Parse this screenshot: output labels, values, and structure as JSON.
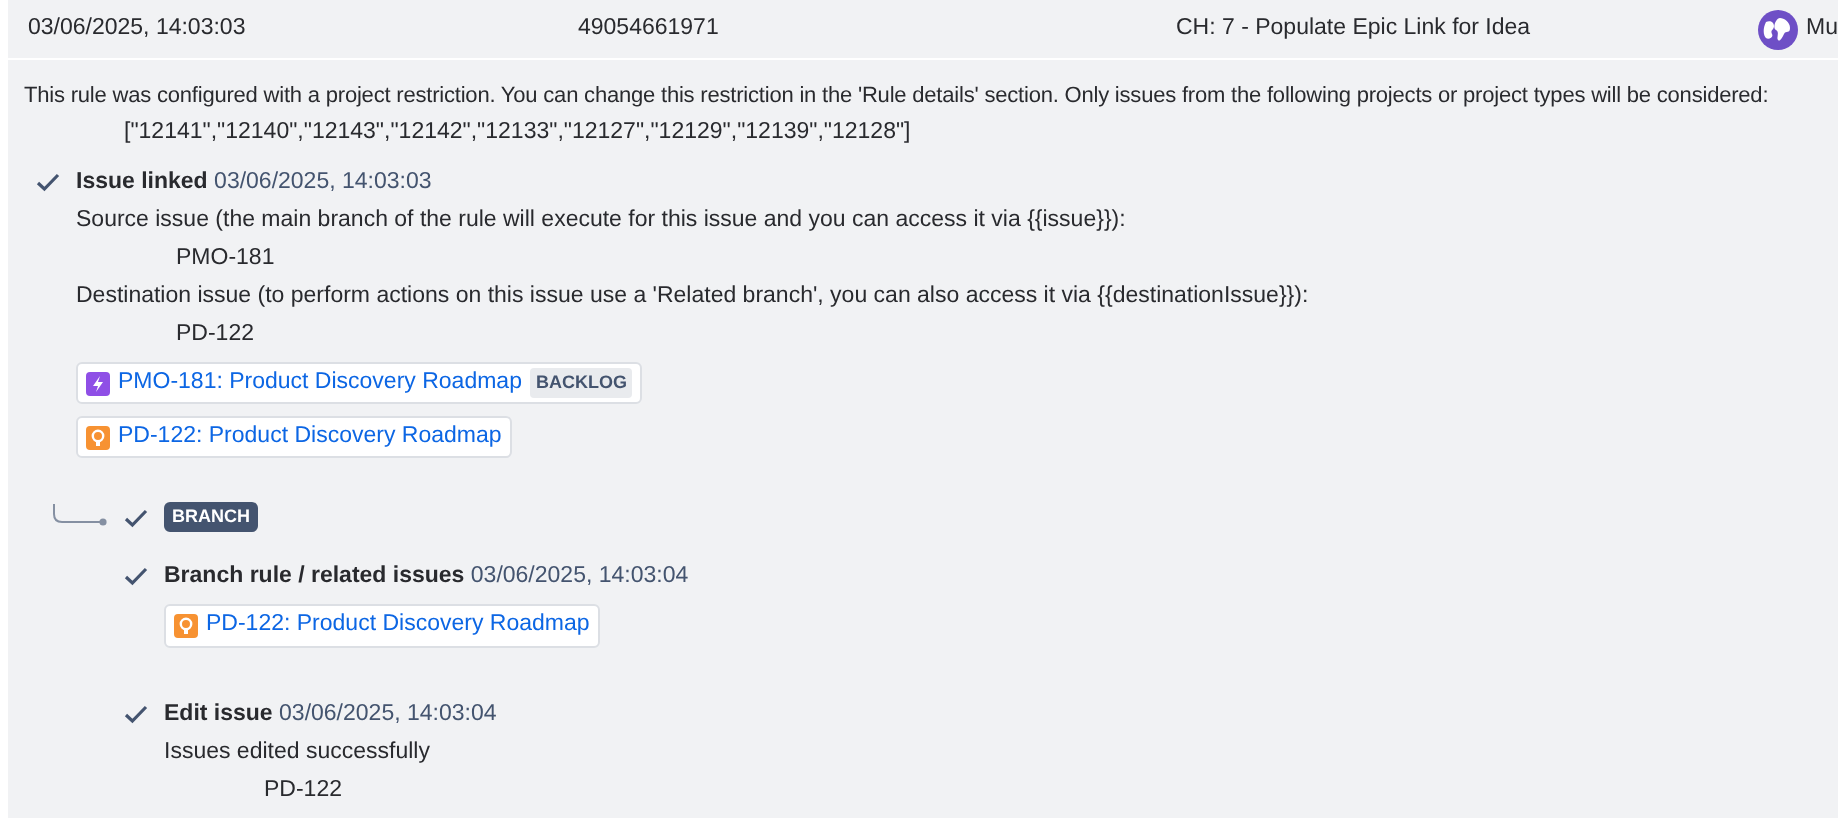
{
  "header": {
    "timestamp": "03/06/2025, 14:03:03",
    "id": "49054661971",
    "rule": "CH: 7 - Populate Epic Link for Idea",
    "user": "Mu"
  },
  "restriction": {
    "message": "This rule was configured with a project restriction. You can change this restriction in the 'Rule details' section. Only issues from the following projects or project types will be considered:",
    "projects": "[\"12141\",\"12140\",\"12143\",\"12142\",\"12133\",\"12127\",\"12129\",\"12139\",\"12128\"]"
  },
  "steps": [
    {
      "kind": "action",
      "title": "Issue linked",
      "time": "03/06/2025, 14:03:03",
      "details": [
        {
          "label": "Source issue (the main branch of the rule will execute for this issue and you can access it via {{issue}}):",
          "value": "PMO-181"
        },
        {
          "label": "Destination issue (to perform actions on this issue use a 'Related branch', you can also access it via {{destinationIssue}}):",
          "value": "PD-122"
        }
      ],
      "issues": [
        {
          "kind": "bolt",
          "text": "PMO-181: Product Discovery Roadmap",
          "status": "BACKLOG"
        },
        {
          "kind": "bulb",
          "text": "PD-122: Product Discovery Roadmap"
        }
      ]
    },
    {
      "kind": "branch",
      "label": "BRANCH",
      "steps": [
        {
          "kind": "action",
          "title": "Branch rule / related issues",
          "time": "03/06/2025, 14:03:04",
          "issues": [
            {
              "kind": "bulb",
              "text": "PD-122: Product Discovery Roadmap"
            }
          ]
        },
        {
          "kind": "action",
          "title": "Edit issue",
          "time": "03/06/2025, 14:03:04",
          "details": [
            {
              "label": "Issues edited successfully",
              "value": "PD-122"
            }
          ]
        }
      ]
    }
  ]
}
